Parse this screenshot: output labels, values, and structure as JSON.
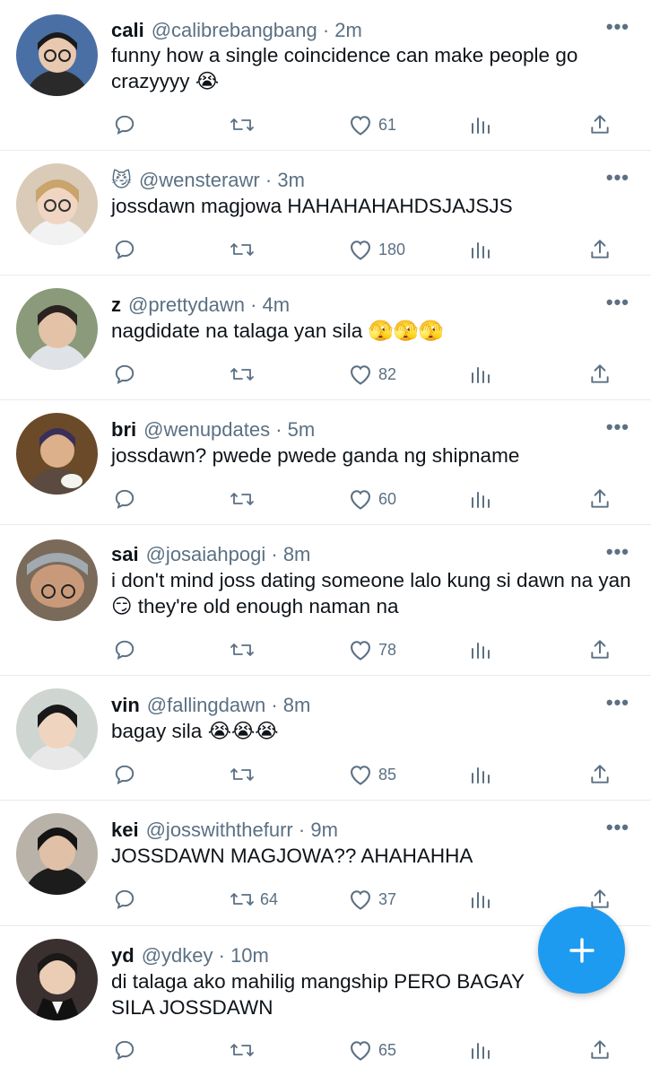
{
  "tweets": [
    {
      "name": "cali",
      "handle": "@calibrebangbang",
      "time": "· 2m",
      "text": "funny how a single coincidence can make people go crazyyyy 😭",
      "retweets": "",
      "likes": "61",
      "avatar": {
        "bg": "#4a6fa5",
        "skin": "#e8c9b0",
        "hair": "#1a1a1a"
      }
    },
    {
      "name": "😼",
      "handle": "@wensterawr",
      "time": "· 3m",
      "text": "jossdawn magjowa HAHAHAHAHDSJAJSJS",
      "retweets": "",
      "likes": "180",
      "avatar": {
        "bg": "#d9cbb8",
        "skin": "#f0d6c2",
        "hair": "#c9a46b"
      }
    },
    {
      "name": "z",
      "handle": "@prettydawn",
      "time": "· 4m",
      "text": "nagdidate na talaga yan sila 🫣🫣🫣",
      "retweets": "",
      "likes": "82",
      "avatar": {
        "bg": "#8a9a7a",
        "skin": "#e3c2a8",
        "hair": "#2a2220"
      }
    },
    {
      "name": "bri",
      "handle": "@wenupdates",
      "time": "· 5m",
      "text": "jossdawn? pwede pwede ganda ng shipname",
      "retweets": "",
      "likes": "60",
      "avatar": {
        "bg": "#6b4a2a",
        "skin": "#dcb08a",
        "hair": "#3a2f5a"
      }
    },
    {
      "name": "sai",
      "handle": "@josaiahpogi",
      "time": "· 8m",
      "text": "i don't mind joss dating someone lalo kung si dawn na yan 😏 they're old enough naman na",
      "retweets": "",
      "likes": "78",
      "avatar": {
        "bg": "#7a6a5a",
        "skin": "#c99a7a",
        "hair": "#2a2a2a"
      }
    },
    {
      "name": "vin",
      "handle": "@fallingdawn",
      "time": "· 8m",
      "text": "bagay sila 😭😭😭",
      "retweets": "",
      "likes": "85",
      "avatar": {
        "bg": "#cfd5d0",
        "skin": "#efd4c0",
        "hair": "#181818"
      }
    },
    {
      "name": "kei",
      "handle": "@josswiththefurr",
      "time": "· 9m",
      "text": "JOSSDAWN MAGJOWA?? AHAHAHHA",
      "retweets": "64",
      "likes": "37",
      "avatar": {
        "bg": "#b8b2a8",
        "skin": "#e0c0a6",
        "hair": "#141414"
      }
    },
    {
      "name": "yd",
      "handle": "@ydkey",
      "time": "· 10m",
      "text": "di talaga ako mahilig mangship PERO BAGAY SILA JOSSDAWN",
      "retweets": "",
      "likes": "65",
      "avatar": {
        "bg": "#3a3030",
        "skin": "#ebcdb5",
        "hair": "#1c1818"
      }
    }
  ],
  "colors": {
    "accent": "#1d9bf0",
    "secondary_text": "#5b7083",
    "divider": "#e6ecf0"
  },
  "icons": {
    "reply": "reply-icon",
    "retweet": "retweet-icon",
    "like": "heart-icon",
    "analytics": "analytics-icon",
    "share": "share-icon",
    "compose": "plus-icon"
  }
}
